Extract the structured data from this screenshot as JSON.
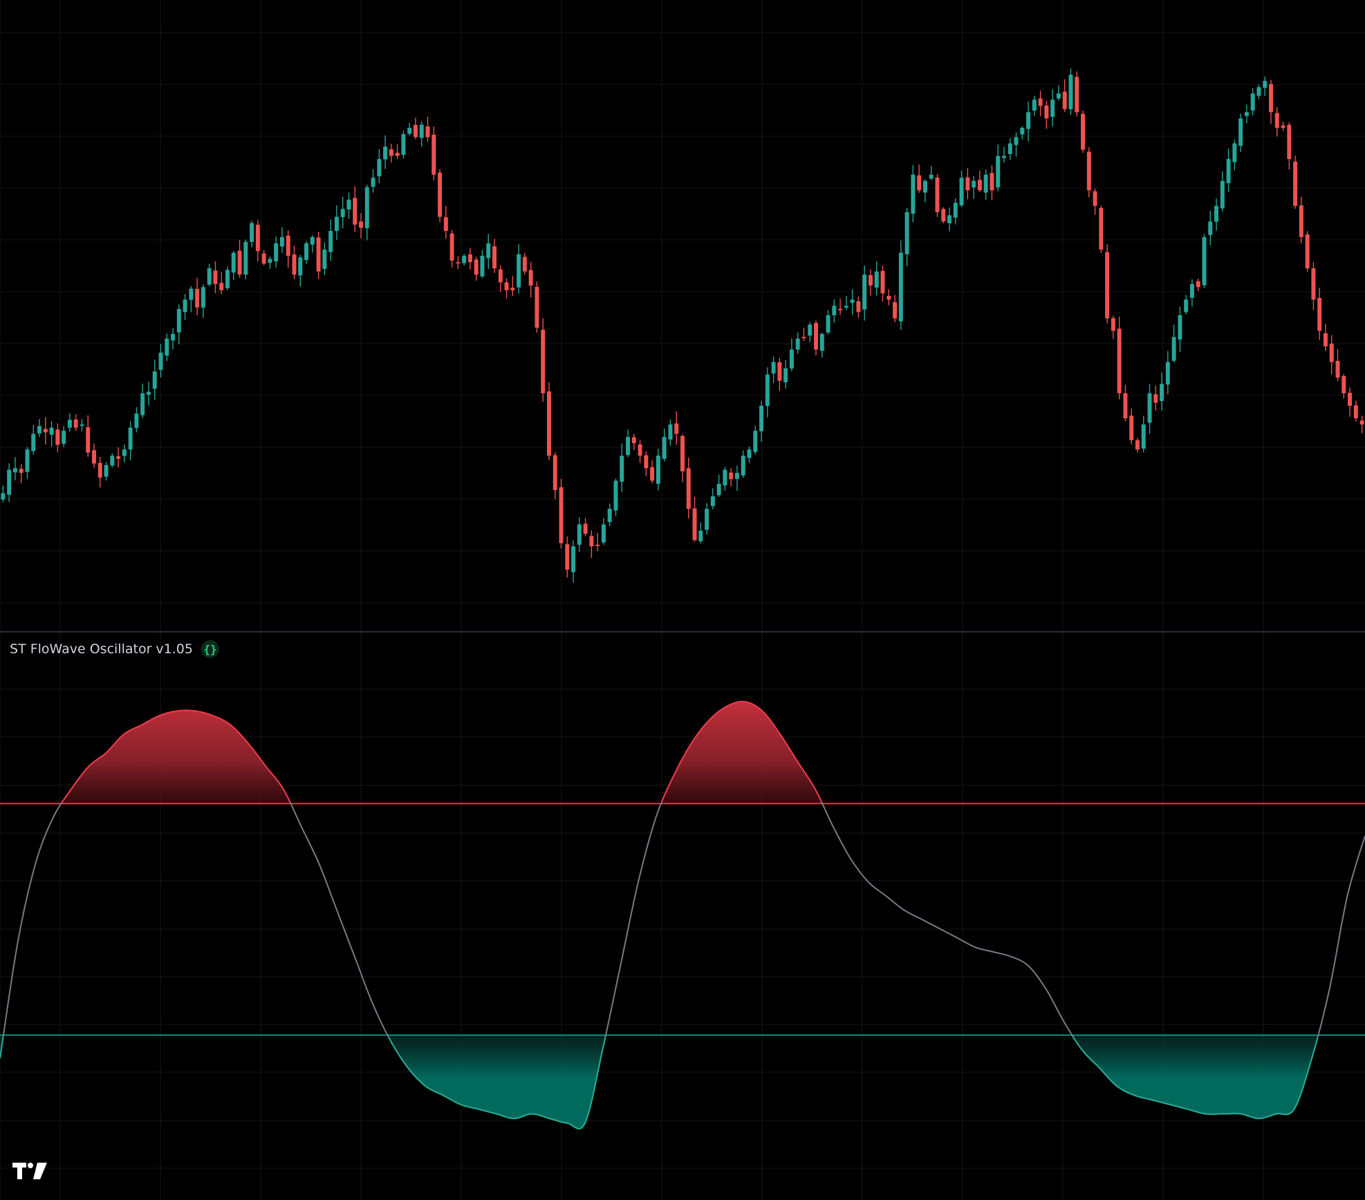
{
  "indicator": {
    "title": "ST FloWave Oscillator v1.05",
    "icon": "code-braces-icon"
  },
  "logo": {
    "icon": "tradingview-logo-icon"
  },
  "colors": {
    "background": "#000000",
    "grid": "#161616",
    "bull": "#26a69a",
    "bear": "#ef5350",
    "overbought": "#f23645",
    "oversold": "#089981",
    "oscillator_line": "#787b86",
    "bear_fill": "#c2303b",
    "bull_fill": "#00695c"
  },
  "chart_data": [
    {
      "type": "candlestick",
      "description_values": "approximate price path of close values (relative units, 0 = chart bottom)",
      "close_path": [
        480,
        555,
        560,
        545,
        620,
        670,
        695,
        675,
        690,
        635,
        680,
        715,
        690,
        700,
        610,
        575,
        530,
        570,
        600,
        590,
        620,
        690,
        735,
        800,
        805,
        870,
        930,
        975,
        990,
        1070,
        1100,
        1135,
        1075,
        1140,
        1200,
        1150,
        1130,
        1195,
        1250,
        1180,
        1285,
        1345,
        1255,
        1215,
        1230,
        1280,
        1300,
        1240,
        1180,
        1235,
        1280,
        1300,
        1190,
        1260,
        1320,
        1365,
        1390,
        1420,
        1340,
        1330,
        1460,
        1490,
        1550,
        1590,
        1560,
        1560,
        1630,
        1650,
        1620,
        1660,
        1620,
        1500,
        1365,
        1320,
        1225,
        1220,
        1240,
        1220,
        1180,
        1240,
        1280,
        1200,
        1155,
        1130,
        1130,
        1245,
        1190,
        1145,
        1010,
        800,
        600,
        490,
        320,
        235,
        310,
        380,
        350,
        310,
        315,
        380,
        430,
        520,
        600,
        660,
        640,
        600,
        560,
        520,
        600,
        660,
        700,
        670,
        550,
        430,
        330,
        360,
        430,
        470,
        510,
        555,
        525,
        545,
        600,
        620,
        680,
        760,
        860,
        900,
        840,
        880,
        940,
        975,
        980,
        1020,
        940,
        990,
        1050,
        1080,
        1070,
        1080,
        1100,
        1060,
        1180,
        1145,
        1190,
        1120,
        1100,
        1040,
        1250,
        1380,
        1500,
        1450,
        1480,
        1500,
        1380,
        1350,
        1370,
        1410,
        1490,
        1450,
        1480,
        1450,
        1500,
        1450,
        1560,
        1560,
        1600,
        1620,
        1650,
        1700,
        1740,
        1720,
        1680,
        1740,
        1760,
        1710,
        1820,
        1700,
        1580,
        1450,
        1400,
        1260,
        1040,
        1000,
        800,
        720,
        650,
        620,
        700,
        800,
        770,
        830,
        900,
        980,
        1050,
        1100,
        1150,
        1140,
        1300,
        1350,
        1400,
        1480,
        1550,
        1600,
        1680,
        1700,
        1760,
        1780,
        1800,
        1700,
        1650,
        1650,
        1550,
        1400,
        1300,
        1200,
        1100,
        1000,
        950,
        900,
        850,
        800,
        760,
        720,
        700
      ]
    },
    {
      "type": "area",
      "name": "",
      "range": [
        0,
        100
      ],
      "levels": {
        "upper": 75,
        "lower": 25
      },
      "values": [
        20,
        45,
        62,
        72,
        78,
        83,
        86,
        90,
        92,
        94,
        95,
        95,
        94,
        92,
        88,
        83,
        78,
        70,
        62,
        52,
        42,
        32,
        24,
        18,
        14,
        12,
        10,
        9,
        8,
        7,
        8,
        7,
        6,
        6,
        22,
        40,
        58,
        72,
        81,
        88,
        93,
        96,
        97,
        95,
        90,
        84,
        78,
        70,
        63,
        58,
        55,
        52,
        50,
        48,
        46,
        44,
        43,
        42,
        40,
        35,
        28,
        22,
        18,
        14,
        12,
        11,
        10,
        9,
        8,
        8,
        8,
        7,
        8,
        9,
        20,
        35,
        55,
        68
      ]
    }
  ]
}
